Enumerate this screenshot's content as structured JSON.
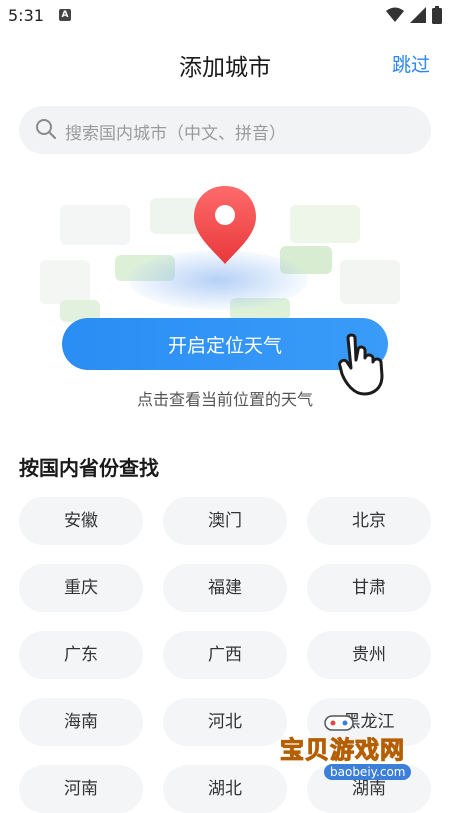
{
  "status_bar": {
    "time": "5:31",
    "badge": "A"
  },
  "header": {
    "title": "添加城市",
    "skip_label": "跳过"
  },
  "search": {
    "placeholder": "搜索国内城市（中文、拼音）"
  },
  "locate": {
    "button_label": "开启定位天气",
    "hint": "点击查看当前位置的天气"
  },
  "provinces": {
    "section_title": "按国内省份查找",
    "items": [
      "安徽",
      "澳门",
      "北京",
      "重庆",
      "福建",
      "甘肃",
      "广东",
      "广西",
      "贵州",
      "海南",
      "河北",
      "黑龙江",
      "河南",
      "湖北",
      "湖南"
    ]
  },
  "watermark": {
    "text": "宝贝游戏网",
    "url": "baobeiy.com"
  },
  "colors": {
    "accent": "#2b86f0",
    "pin": "#ef4a4a",
    "chip_bg": "#f4f5f7"
  }
}
